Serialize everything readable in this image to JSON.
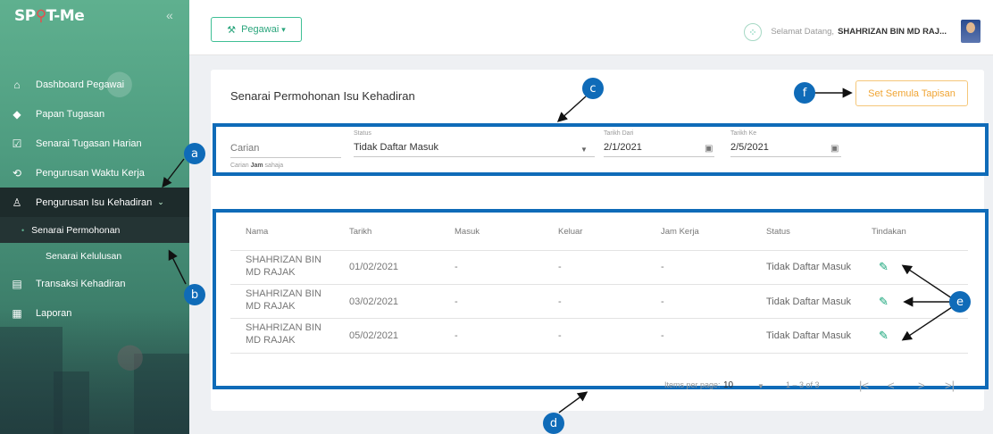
{
  "app": {
    "logo_text_a": "SP",
    "logo_text_b": "T-Me"
  },
  "sidebar": {
    "items": [
      {
        "label": "Dashboard Pegawai",
        "icon": "home-icon"
      },
      {
        "label": "Papan Tugasan",
        "icon": "tag-icon"
      },
      {
        "label": "Senarai Tugasan Harian",
        "icon": "checklist-icon"
      },
      {
        "label": "Pengurusan Waktu Kerja",
        "icon": "clock-icon"
      },
      {
        "label": "Pengurusan Isu Kehadiran",
        "icon": "user-icon"
      },
      {
        "label": "Senarai Permohonan"
      },
      {
        "label": "Senarai Kelulusan"
      },
      {
        "label": "Transaksi Kehadiran",
        "icon": "list-icon"
      },
      {
        "label": "Laporan",
        "icon": "report-icon"
      }
    ]
  },
  "header": {
    "role_label": "Pegawai",
    "welcome_text": "Selamat Datang,",
    "user_name": "SHAHRIZAN BIN MD RAJ..."
  },
  "page": {
    "title": "Senarai Permohonan Isu Kehadiran",
    "reset_label": "Set Semula Tapisan"
  },
  "filters": {
    "search_label": "Carian",
    "search_hint_prefix": "Carian",
    "search_hint_bold": "Jam",
    "search_hint_suffix": "sahaja",
    "status_label": "Status",
    "status_value": "Tidak Daftar Masuk",
    "from_label": "Tarikh Dari",
    "from_value": "2/1/2021",
    "to_label": "Tarikh Ke",
    "to_value": "2/5/2021"
  },
  "table": {
    "headers": [
      "Nama",
      "Tarikh",
      "Masuk",
      "Keluar",
      "Jam Kerja",
      "Status",
      "Tindakan"
    ],
    "rows": [
      {
        "name": "SHAHRIZAN BIN MD RAJAK",
        "date": "01/02/2021",
        "in": "-",
        "out": "-",
        "hours": "-",
        "status": "Tidak Daftar Masuk"
      },
      {
        "name": "SHAHRIZAN BIN MD RAJAK",
        "date": "03/02/2021",
        "in": "-",
        "out": "-",
        "hours": "-",
        "status": "Tidak Daftar Masuk"
      },
      {
        "name": "SHAHRIZAN BIN MD RAJAK",
        "date": "05/02/2021",
        "in": "-",
        "out": "-",
        "hours": "-",
        "status": "Tidak Daftar Masuk"
      }
    ]
  },
  "pagination": {
    "items_label": "Items per page:",
    "page_size": "10",
    "range": "1 – 3 of 3"
  },
  "callouts": {
    "a": "a",
    "b": "b",
    "c": "c",
    "d": "d",
    "e": "e",
    "f": "f"
  },
  "colors": {
    "accent": "#3fbf95",
    "annotation": "#0f6bb8",
    "reset": "#f0a534"
  }
}
